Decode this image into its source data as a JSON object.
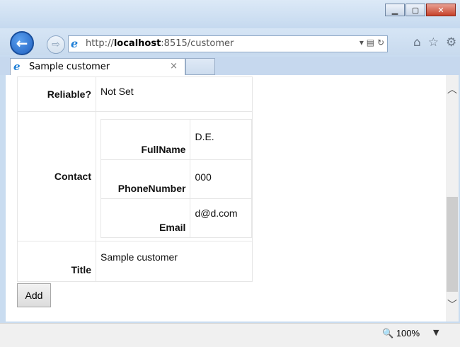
{
  "browser": {
    "url_prefix": "http://",
    "url_host": "localhost",
    "url_rest": ":8515/customer",
    "tab_title": "Sample customer",
    "tab_close": "×",
    "zoom": "100%"
  },
  "record": {
    "reliable_label": "Reliable?",
    "reliable_value": "Not Set",
    "contact_label": "Contact",
    "contact": [
      {
        "label": "FullName",
        "value": "D.E."
      },
      {
        "label": "PhoneNumber",
        "value": "000"
      },
      {
        "label": "Email",
        "value": "d@d.com"
      }
    ],
    "title_label": "Title",
    "title_value": "Sample customer"
  },
  "actions": {
    "add_label": "Add"
  },
  "icons": {
    "back": "back-arrow-icon",
    "forward": "forward-arrow-icon",
    "home": "home-icon",
    "favorites": "star-icon",
    "settings": "gear-icon"
  }
}
